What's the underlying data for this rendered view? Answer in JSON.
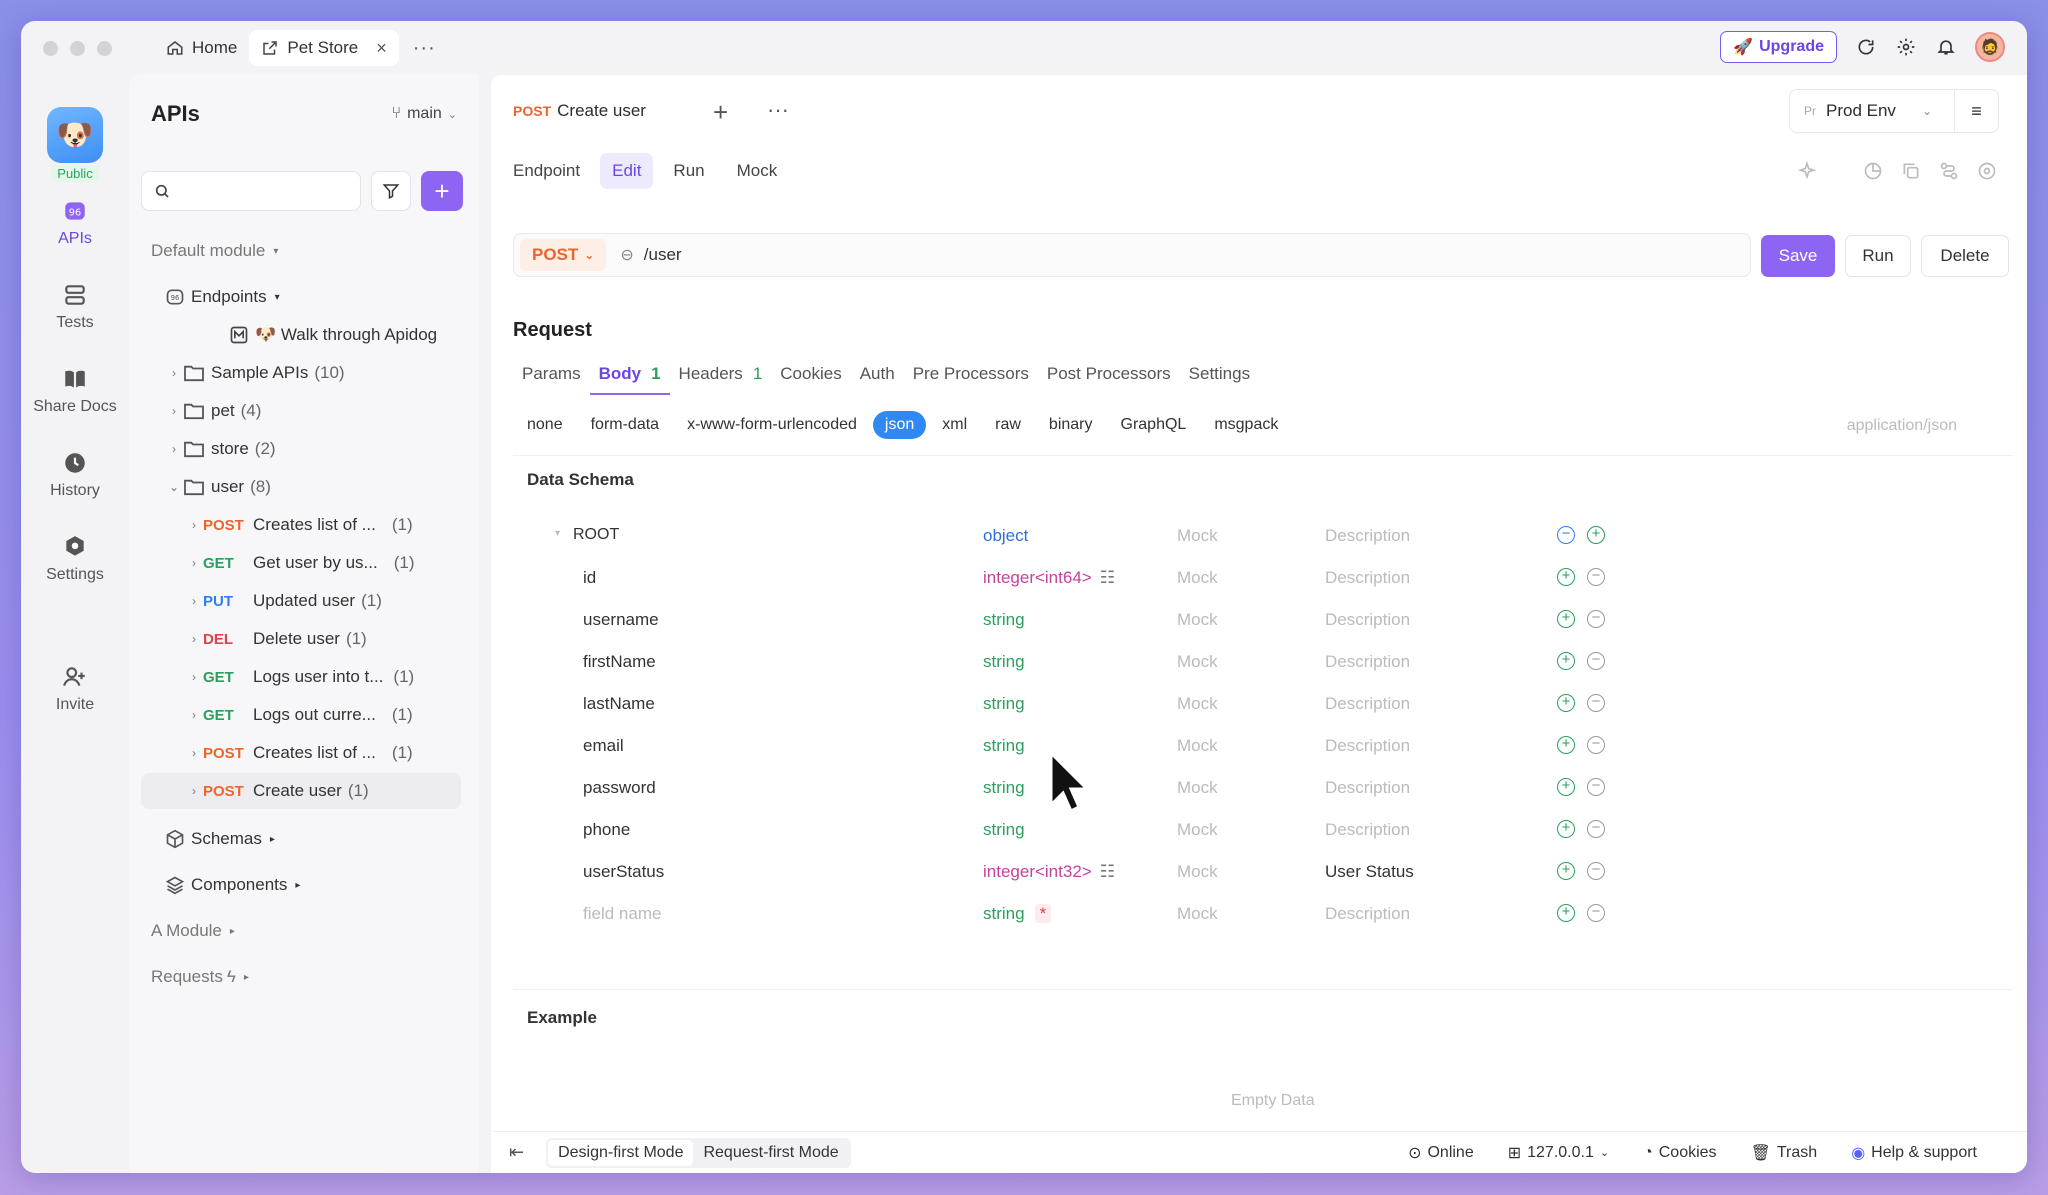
{
  "titlebar": {
    "tabs": [
      {
        "label": "Home",
        "icon": "home-icon"
      },
      {
        "label": "Pet Store",
        "icon": "external-link-icon",
        "close": "×"
      }
    ],
    "more": "···",
    "upgrade_label": "Upgrade"
  },
  "rail": {
    "public_badge": "Public",
    "items": [
      {
        "label": "APIs",
        "icon": "apis-icon"
      },
      {
        "label": "Tests",
        "icon": "tests-icon"
      },
      {
        "label": "Share Docs",
        "icon": "book-icon"
      },
      {
        "label": "History",
        "icon": "clock-icon"
      },
      {
        "label": "Settings",
        "icon": "gear-icon"
      },
      {
        "label": "Invite",
        "icon": "add-user-icon"
      }
    ]
  },
  "left_panel": {
    "title": "APIs",
    "branch": "main",
    "search_placeholder": "",
    "default_module": "Default module",
    "endpoints_label": "Endpoints",
    "walk_through": "🐶 Walk through Apidog",
    "folders": [
      {
        "name": "Sample APIs",
        "count": "(10)"
      },
      {
        "name": "pet",
        "count": "(4)"
      },
      {
        "name": "store",
        "count": "(2)"
      },
      {
        "name": "user",
        "count": "(8)"
      }
    ],
    "user_endpoints": [
      {
        "method": "POST",
        "name": "Creates list of ...",
        "count": "(1)"
      },
      {
        "method": "GET",
        "name": "Get user by us...",
        "count": "(1)"
      },
      {
        "method": "PUT",
        "name": "Updated user",
        "count": "(1)"
      },
      {
        "method": "DEL",
        "name": "Delete user",
        "count": "(1)"
      },
      {
        "method": "GET",
        "name": "Logs user into t...",
        "count": "(1)"
      },
      {
        "method": "GET",
        "name": "Logs out curre...",
        "count": "(1)"
      },
      {
        "method": "POST",
        "name": "Creates list of ...",
        "count": "(1)"
      },
      {
        "method": "POST",
        "name": "Create user",
        "count": "(1)"
      }
    ],
    "schemas_label": "Schemas",
    "components_label": "Components",
    "a_module_label": "A Module",
    "requests_label": "Requests"
  },
  "main": {
    "doc_tab": {
      "method": "POST",
      "title": "Create user",
      "plus": "+",
      "more": "···"
    },
    "env": {
      "prefix": "Pr",
      "name": "Prod Env"
    },
    "mode_tabs": [
      "Endpoint",
      "Edit",
      "Run",
      "Mock"
    ],
    "url": {
      "method": "POST",
      "path": "/user"
    },
    "buttons": {
      "save": "Save",
      "run": "Run",
      "delete": "Delete"
    },
    "request_title": "Request",
    "request_tabs": [
      {
        "label": "Params",
        "count": ""
      },
      {
        "label": "Body",
        "count": "1"
      },
      {
        "label": "Headers",
        "count": "1"
      },
      {
        "label": "Cookies",
        "count": ""
      },
      {
        "label": "Auth",
        "count": ""
      },
      {
        "label": "Pre Processors",
        "count": ""
      },
      {
        "label": "Post Processors",
        "count": ""
      },
      {
        "label": "Settings",
        "count": ""
      }
    ],
    "body_types": [
      "none",
      "form-data",
      "x-www-form-urlencoded",
      "json",
      "xml",
      "raw",
      "binary",
      "GraphQL",
      "msgpack"
    ],
    "content_type": "application/json",
    "schema_title": "Data Schema",
    "root": {
      "name": "ROOT",
      "type": "object",
      "mock": "Mock",
      "desc": "Description"
    },
    "fields": [
      {
        "name": "id",
        "type": "integer<int64>",
        "mock": "Mock",
        "desc": "Description"
      },
      {
        "name": "username",
        "type": "string",
        "mock": "Mock",
        "desc": "Description"
      },
      {
        "name": "firstName",
        "type": "string",
        "mock": "Mock",
        "desc": "Description"
      },
      {
        "name": "lastName",
        "type": "string",
        "mock": "Mock",
        "desc": "Description"
      },
      {
        "name": "email",
        "type": "string",
        "mock": "Mock",
        "desc": "Description"
      },
      {
        "name": "password",
        "type": "string",
        "mock": "Mock",
        "desc": "Description"
      },
      {
        "name": "phone",
        "type": "string",
        "mock": "Mock",
        "desc": "Description"
      },
      {
        "name": "userStatus",
        "type": "integer<int32>",
        "mock": "Mock",
        "desc": "User Status"
      }
    ],
    "new_field": {
      "placeholder": "field name",
      "type": "string",
      "required": "*",
      "mock": "Mock",
      "desc": "Description"
    },
    "example_title": "Example",
    "empty_data": "Empty Data"
  },
  "statusbar": {
    "modes": [
      "Design-first Mode",
      "Request-first Mode"
    ],
    "online": "Online",
    "host": "127.0.0.1",
    "cookies": "Cookies",
    "trash": "Trash",
    "help": "Help & support"
  }
}
